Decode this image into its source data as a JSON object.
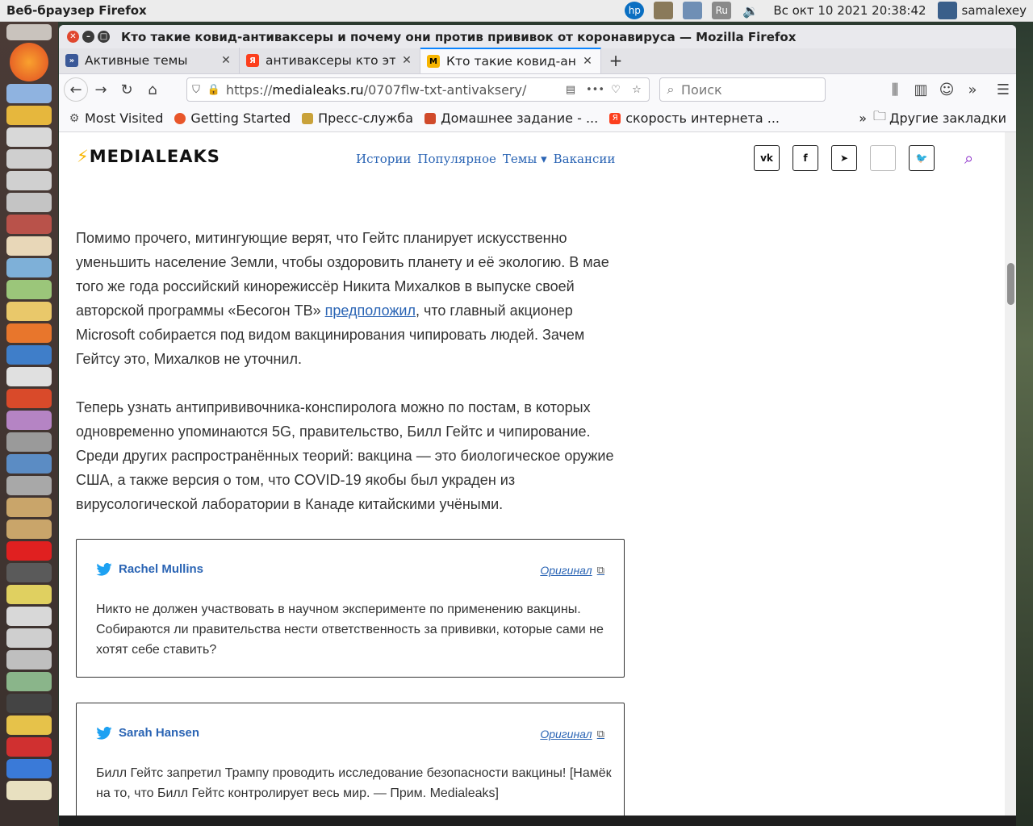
{
  "system_panel": {
    "title": "Веб-браузер Firefox",
    "keyboard_layout": "Ru",
    "clock": "Вс окт 10 2021 20:38:42",
    "user": "samalexey"
  },
  "window": {
    "title": "Кто такие ковид-антиваксеры и почему они против прививок от коронавируса — Mozilla Firefox"
  },
  "tabs": [
    {
      "label": "Активные темы",
      "favicon_color": "#3b5998",
      "active": false
    },
    {
      "label": "антиваксеры кто это",
      "favicon_color": "#fc3f1d",
      "active": false
    },
    {
      "label": "Кто такие ковид-антива",
      "favicon_color": "#f7b500",
      "active": true
    }
  ],
  "toolbar": {
    "url_prefix": "https://",
    "url_host": "medialeaks.ru",
    "url_path": "/0707flw-txt-antivaksery/",
    "search_placeholder": "Поиск"
  },
  "bookmarks": [
    {
      "label": "Most Visited",
      "icon": "gear-icon"
    },
    {
      "label": "Getting Started",
      "icon": "firefox-icon"
    },
    {
      "label": "Пресс-служба",
      "icon": "emblem-icon"
    },
    {
      "label": "Домашнее задание - ...",
      "icon": "home-icon"
    },
    {
      "label": "скорость интернета ...",
      "icon": "yandex-icon"
    }
  ],
  "bookmarks_other": "Другие закладки",
  "site": {
    "logo": "MEDIALEAKS",
    "nav": [
      "Истории",
      "Популярное",
      "Темы ▾",
      "Вакансии"
    ],
    "socials": [
      "vk-icon",
      "facebook-icon",
      "telegram-icon",
      "zen-icon",
      "twitter-icon"
    ]
  },
  "article": {
    "p1_a": "Помимо прочего, митингующие верят, что Гейтс планирует искусственно уменьшить население Земли, чтобы оздоровить планету и её экологию. В мае того же года российский кинорежиссёр Никита Михалков в выпуске своей авторской программы «Бесогон ТВ» ",
    "p1_link": "предположил",
    "p1_b": ", что главный акционер Microsoft собирается под видом вакцинирования чипировать людей. Зачем Гейтсу это, Михалков не уточнил.",
    "p2": "Теперь узнать антипрививочника-конспиролога можно по постам, в которых одновременно упоминаются 5G, правительство, Билл Гейтс и чипирование. Среди других распространённых теорий: вакцина — это биологическое оружие США, а также версия о том, что COVID-19 якобы был украден из вирусологической лаборатории в Канаде китайскими учёными.",
    "tweets": [
      {
        "author": "Rachel Mullins",
        "original": "Оригинал",
        "text": "Никто не должен участвовать в научном эксперименте по применению вакцины. Собираются ли правительства нести ответственность за прививки, которые сами не хотят себе ставить?"
      },
      {
        "author": "Sarah Hansen",
        "original": "Оригинал",
        "text": "Билл Гейтс запретил Трампу проводить исследование безопасности вакцины! [Намёк на то, что Билл Гейтс контролирует весь мир. — Прим. Medialeaks]"
      }
    ]
  }
}
